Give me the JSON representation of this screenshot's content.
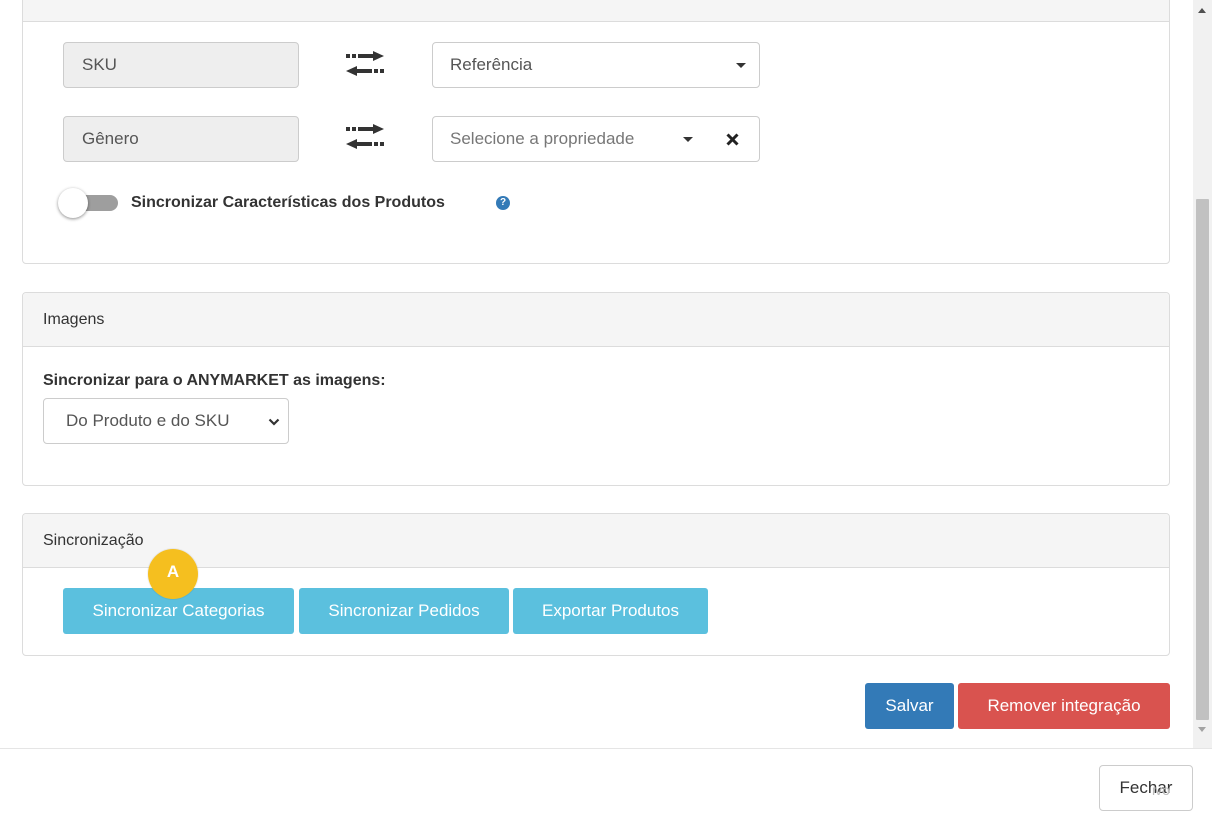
{
  "attributes_panel": {
    "rows": [
      {
        "source": "SKU",
        "target": "Referência",
        "target_is_placeholder": false
      },
      {
        "source": "Gênero",
        "target": "Selecione a propriedade",
        "target_is_placeholder": true
      }
    ],
    "sync_toggle": {
      "label": "Sincronizar Características dos Produtos",
      "checked": false
    },
    "help_symbol": "?"
  },
  "images_panel": {
    "title": "Imagens",
    "field_label": "Sincronizar para o ANYMARKET as imagens:",
    "selected_option": "Do Produto e do SKU"
  },
  "sync_panel": {
    "title": "Sincronização",
    "buttons": [
      "Sincronizar Categorias",
      "Sincronizar Pedidos",
      "Exportar Produtos"
    ],
    "annotation_badge": "A"
  },
  "actions": {
    "save": "Salvar",
    "remove": "Remover integração"
  },
  "footer": {
    "close": "Fechar",
    "ghost_text": "ivo"
  },
  "colors": {
    "info": "#5bc0de",
    "primary": "#337ab7",
    "danger": "#d9534f",
    "badge": "#f5bf1f",
    "toggle_off": "#9e9e9e"
  },
  "icons": {
    "swap": "exchange-arrows-icon",
    "caret": "caret-down-icon",
    "clear": "times-icon",
    "help": "question-circle-icon",
    "chevron": "chevron-down-icon"
  }
}
